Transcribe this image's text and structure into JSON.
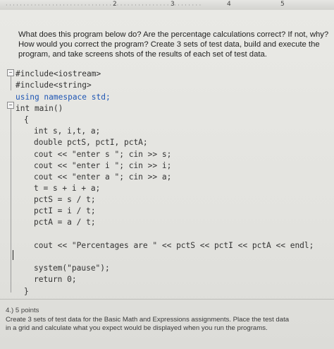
{
  "ruler": {
    "numbers": [
      "2",
      "3",
      "4",
      "5"
    ]
  },
  "question": {
    "line1": "What does this program below do?  Are the percentage calculations correct?  If not, why?",
    "line2": "How would you correct the program?  Create 3 sets of test data, build and execute the",
    "line3": "program, and take screens shots of the results of each set of test data."
  },
  "code": {
    "lines": [
      "#include<iostream>",
      "#include<string>",
      "using namespace std;",
      "int main()",
      "{",
      "int s, i,t, a;",
      "double pctS, pctI, pctA;",
      "cout << \"enter s \"; cin >> s;",
      "cout << \"enter i \"; cin >> i;",
      "cout << \"enter a \"; cin >> a;",
      "t = s + i + a;",
      "pctS = s / t;",
      "pctI = i / t;",
      "pctA = a / t;",
      "cout << \"Percentages are \" << pctS << pctI << pctA << endl;",
      "system(\"pause\");",
      "return 0;",
      "}"
    ]
  },
  "question4": {
    "heading": "4.)  5 points",
    "line1": "Create 3 sets of test data for the Basic Math and Expressions assignments. Place the test data",
    "line2": "in a grid and calculate what you expect would be displayed when you run the programs."
  }
}
